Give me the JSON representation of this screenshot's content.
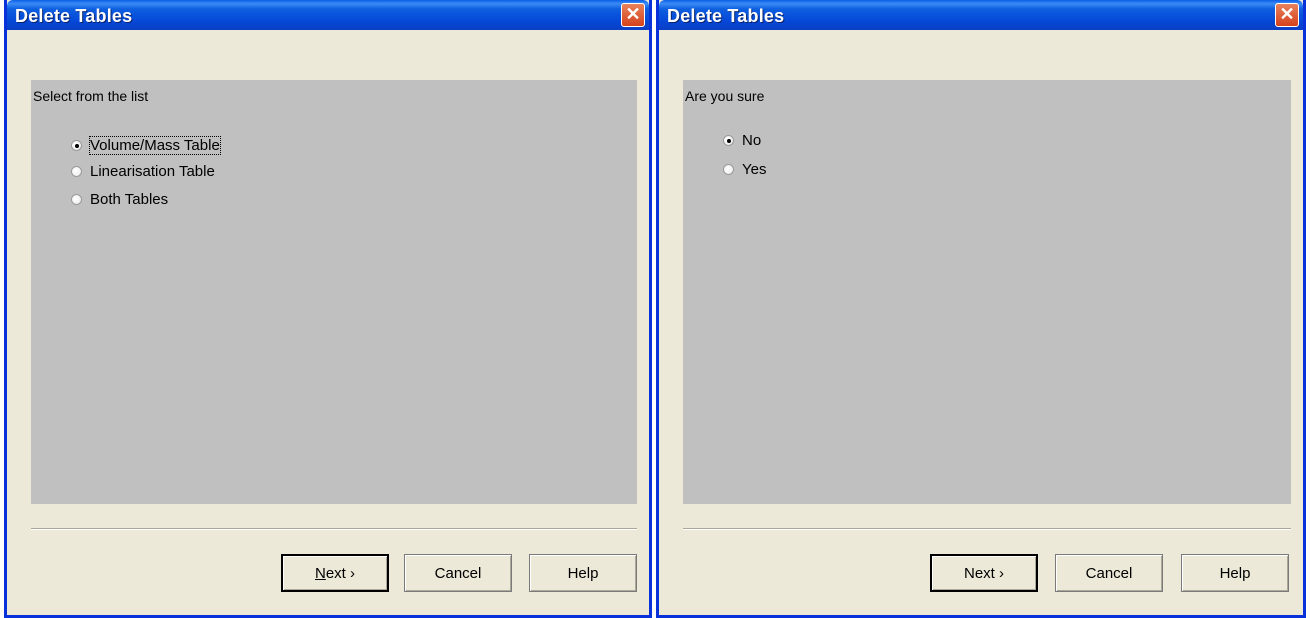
{
  "left_dialog": {
    "title": "Delete Tables",
    "close_glyph": "✕",
    "prompt": "Select from the list",
    "options": [
      {
        "label": "Volume/Mass Table",
        "checked": true
      },
      {
        "label": "Linearisation Table",
        "checked": false
      },
      {
        "label": "Both Tables",
        "checked": false
      }
    ],
    "buttons": {
      "next_mnemonic": "N",
      "next_rest": "ext ›",
      "cancel": "Cancel",
      "help": "Help"
    }
  },
  "right_dialog": {
    "title": "Delete Tables",
    "close_glyph": "✕",
    "prompt": "Are you sure",
    "options": [
      {
        "label": "No",
        "checked": true
      },
      {
        "label": "Yes",
        "checked": false
      }
    ],
    "buttons": {
      "next": "Next ›",
      "cancel": "Cancel",
      "help": "Help"
    }
  },
  "colors": {
    "title_bar": "#0548d8",
    "content_bg": "#c0c0c0",
    "dialog_bg": "#ece9d8",
    "close_button": "#d4421b"
  }
}
